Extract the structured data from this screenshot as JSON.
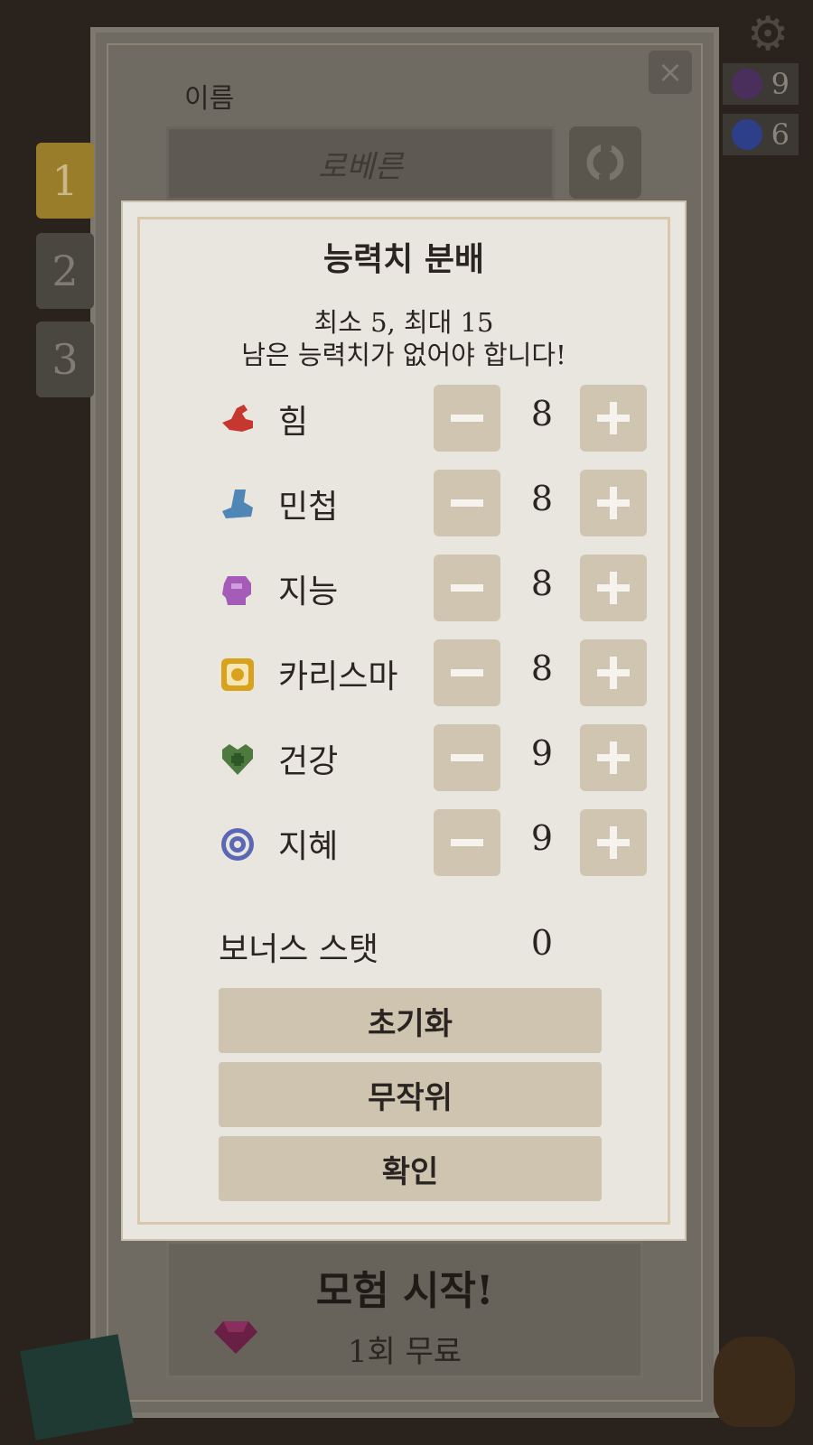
{
  "background": {
    "name_label": "이름",
    "name_value": "로베른",
    "close_icon": "×",
    "gear_icon": "⚙",
    "counters": [
      {
        "value": "9",
        "color": "#4a2f5c"
      },
      {
        "value": "6",
        "color": "#2e3f8a"
      }
    ],
    "slots": [
      "1",
      "2",
      "3"
    ],
    "start_title": "모험 시작!",
    "start_sub": "1회 무료"
  },
  "modal": {
    "title": "능력치 분배",
    "subtitle_line1": "최소 5, 최대 15",
    "subtitle_line2": "남은 능력치가 없어야 합니다!",
    "stats": [
      {
        "label": "힘",
        "value": "8",
        "icon": "arm-icon",
        "color": "#c6382f"
      },
      {
        "label": "민첩",
        "value": "8",
        "icon": "boot-icon",
        "color": "#4e86b6"
      },
      {
        "label": "지능",
        "value": "8",
        "icon": "head-icon",
        "color": "#a55cb8"
      },
      {
        "label": "카리스마",
        "value": "8",
        "icon": "charisma-icon",
        "color": "#d9a21c"
      },
      {
        "label": "건강",
        "value": "9",
        "icon": "heart-icon",
        "color": "#4e7a3f"
      },
      {
        "label": "지혜",
        "value": "9",
        "icon": "wisdom-icon",
        "color": "#5b67b4"
      }
    ],
    "bonus_label": "보너스 스탯",
    "bonus_value": "0",
    "buttons": {
      "reset": "초기화",
      "random": "무작위",
      "confirm": "확인"
    }
  }
}
